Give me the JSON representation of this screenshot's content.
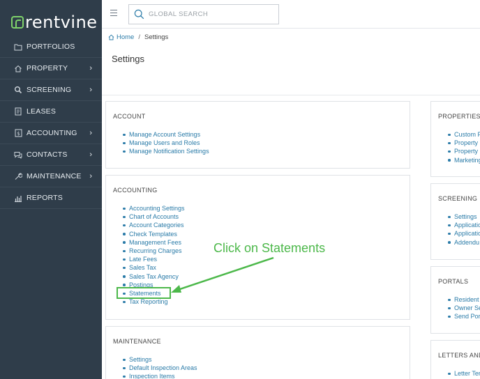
{
  "brand": {
    "name": "rentvine",
    "accent": "#7fd36b"
  },
  "sidebar": {
    "items": [
      {
        "label": "PORTFOLIOS",
        "icon": "folder-icon",
        "has_children": false
      },
      {
        "label": "PROPERTY",
        "icon": "home-icon",
        "has_children": true
      },
      {
        "label": "SCREENING",
        "icon": "magnify-icon",
        "has_children": true
      },
      {
        "label": "LEASES",
        "icon": "document-icon",
        "has_children": false
      },
      {
        "label": "ACCOUNTING",
        "icon": "ledger-icon",
        "has_children": true
      },
      {
        "label": "CONTACTS",
        "icon": "chat-icon",
        "has_children": true
      },
      {
        "label": "MAINTENANCE",
        "icon": "wrench-icon",
        "has_children": true
      },
      {
        "label": "REPORTS",
        "icon": "bar-chart-icon",
        "has_children": false
      }
    ]
  },
  "topbar": {
    "search_placeholder": "GLOBAL SEARCH"
  },
  "breadcrumb": {
    "home": "Home",
    "sep": "/",
    "current": "Settings"
  },
  "page": {
    "title": "Settings"
  },
  "cards": {
    "account": {
      "title": "ACCOUNT",
      "links": [
        "Manage Account Settings",
        "Manage Users and Roles",
        "Manage Notification Settings"
      ]
    },
    "accounting": {
      "title": "ACCOUNTING",
      "links": [
        "Accounting Settings",
        "Chart of Accounts",
        "Account Categories",
        "Check Templates",
        "Management Fees",
        "Recurring Charges",
        "Late Fees",
        "Sales Tax",
        "Sales Tax Agency",
        "Postings",
        "Statements",
        "Tax Reporting"
      ]
    },
    "maintenance": {
      "title": "MAINTENANCE",
      "links": [
        "Settings",
        "Default Inspection Areas",
        "Inspection Items"
      ]
    },
    "properties": {
      "title": "PROPERTIES &",
      "links": [
        "Custom F",
        "Property",
        "Property",
        "Marketing"
      ]
    },
    "screening": {
      "title": "SCREENING",
      "links": [
        "Settings",
        "Applicatio",
        "Applicatio",
        "Addendu"
      ]
    },
    "portals": {
      "title": "PORTALS",
      "links": [
        "Resident",
        "Owner Se",
        "Send Por"
      ]
    },
    "letters": {
      "title": "LETTERS AND I",
      "links": [
        "Letter Ter"
      ]
    }
  },
  "annotation": {
    "text": "Click on Statements",
    "color": "#4cb84a"
  }
}
